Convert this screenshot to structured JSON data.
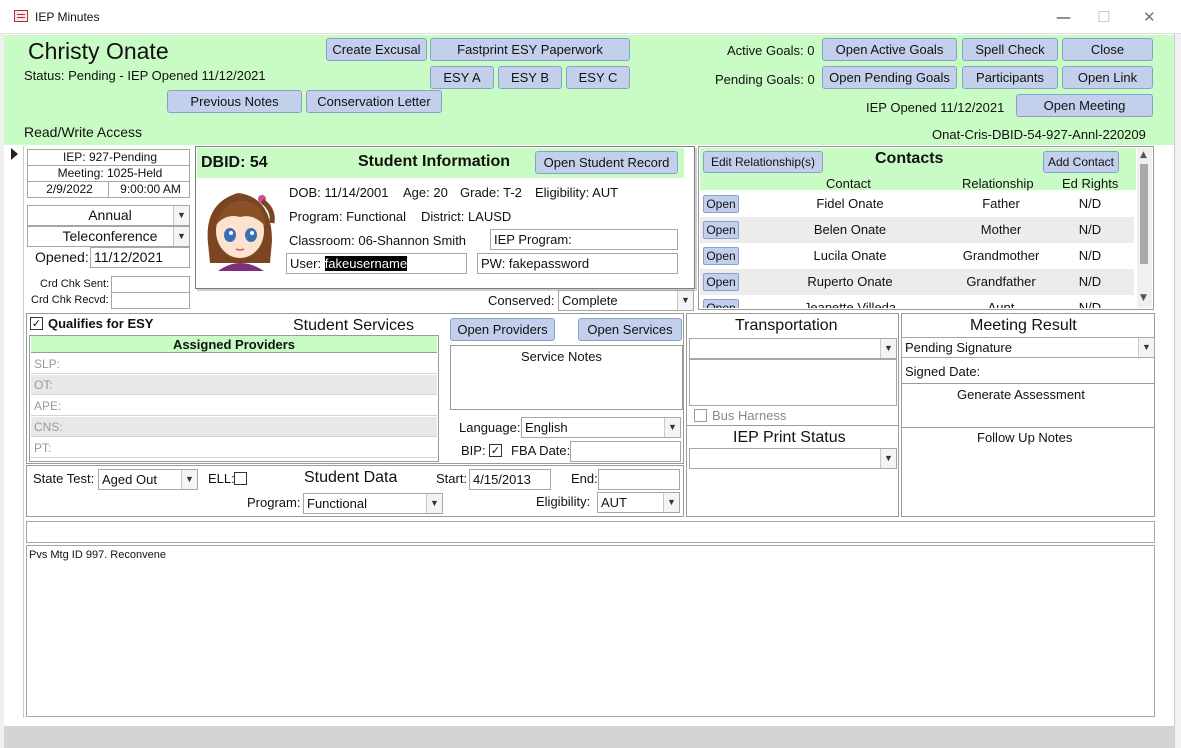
{
  "window": {
    "title": "IEP Minutes",
    "min": "—",
    "max": "☐",
    "close": "✕"
  },
  "header": {
    "student_name": "Christy Onate",
    "status": "Status: Pending - IEP Opened 11/12/2021",
    "access": "Read/Write Access",
    "buttons": {
      "create_excusal": "Create  Excusal",
      "fastprint": "Fastprint ESY Paperwork",
      "esy_a": "ESY A",
      "esy_b": "ESY B",
      "esy_c": "ESY C",
      "previous_notes": "Previous Notes",
      "conservation_letter": "Conservation Letter",
      "open_active_goals": "Open Active Goals",
      "spell_check": "Spell Check",
      "close": "Close",
      "open_pending_goals": "Open Pending Goals",
      "participants": "Participants",
      "open_link": "Open Link",
      "open_meeting": "Open Meeting"
    },
    "active_goals": "Active Goals: 0",
    "pending_goals": "Pending Goals: 0",
    "iep_opened": "IEP Opened 11/12/2021",
    "record_code": "Onat-Cris-DBID-54-927-Annl-220209"
  },
  "meeting": {
    "iep": "IEP: 927-Pending",
    "meeting": "Meeting: 1025-Held",
    "date": "2/9/2022",
    "time": "9:00:00 AM",
    "type": "Annual",
    "mode": "Teleconference",
    "opened_label": "Opened:",
    "opened_value": "11/12/2021",
    "crd_sent_label": "Crd Chk Sent:",
    "crd_recvd_label": "Crd Chk Recvd:"
  },
  "student": {
    "dbid": "DBID: 54",
    "section_title": "Student Information",
    "open_record": "Open Student Record",
    "dob": "DOB: 11/14/2001",
    "age": "Age: 20",
    "grade": "Grade: T-2",
    "eligibility": "Eligibility: AUT",
    "program": "Program: Functional",
    "district": "District: LAUSD",
    "classroom": "Classroom: 06-Shannon Smith",
    "iep_program": "IEP Program:",
    "user_label": "User:",
    "user_value": "fakeusername",
    "pw": "PW: fakepassword",
    "conserved_label": "Conserved:",
    "conserved_value": "Complete"
  },
  "contacts": {
    "edit_btn": "Edit Relationship(s)",
    "title": "Contacts",
    "add_btn": "Add Contact",
    "headers": [
      "Contact",
      "Relationship",
      "Ed Rights"
    ],
    "open_label": "Open",
    "rows": [
      {
        "name": "Fidel Onate",
        "rel": "Father",
        "rights": "N/D"
      },
      {
        "name": "Belen Onate",
        "rel": "Mother",
        "rights": "N/D"
      },
      {
        "name": "Lucila Onate",
        "rel": "Grandmother",
        "rights": "N/D"
      },
      {
        "name": "Ruperto Onate",
        "rel": "Grandfather",
        "rights": "N/D"
      },
      {
        "name": "Jeanette Villeda",
        "rel": "Aunt",
        "rights": "N/D"
      }
    ]
  },
  "services": {
    "qualifies": "Qualifies for ESY",
    "title": "Student Services",
    "open_providers": "Open Providers",
    "open_services": "Open Services",
    "assigned": "Assigned Providers",
    "providers": [
      "SLP:",
      "OT:",
      "APE:",
      "CNS:",
      "PT:"
    ],
    "service_notes": "Service Notes",
    "language_label": "Language:",
    "language_value": "English",
    "bip_label": "BIP:",
    "fba_label": "FBA Date:"
  },
  "transport": {
    "title": "Transportation",
    "bus_harness": "Bus Harness",
    "print_status": "IEP Print Status"
  },
  "result": {
    "title": "Meeting Result",
    "value": "Pending Signature",
    "signed": "Signed Date:",
    "generate": "Generate Assessment",
    "followup": "Follow Up Notes"
  },
  "student_data": {
    "state_test_label": "State Test:",
    "state_test_value": "Aged Out",
    "ell_label": "ELL:",
    "title": "Student Data",
    "start_label": "Start:",
    "start_value": "4/15/2013",
    "end_label": "End:",
    "program_label": "Program:",
    "program_value": "Functional",
    "elig_label": "Eligibility:",
    "elig_value": "AUT"
  },
  "notes": {
    "text": "Pvs Mtg ID 997.  Reconvene"
  }
}
